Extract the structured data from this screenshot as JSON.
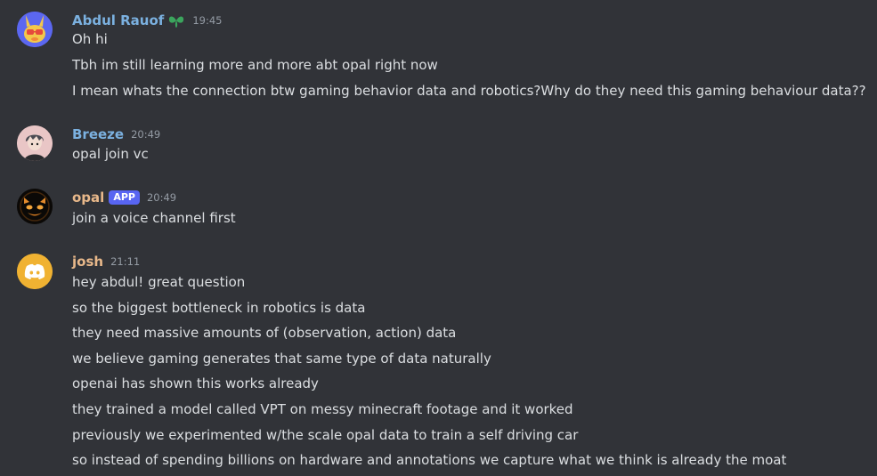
{
  "colors": {
    "background": "#313338",
    "text": "#dbdee1",
    "timestamp": "#949ba4",
    "app_badge": "#5865f2"
  },
  "messages": [
    {
      "username": "Abdul Rauof",
      "username_color": "#7bb1e0",
      "badge_icon": "leaf-icon",
      "time": "19:45",
      "avatar_icon": "yellow-bunny-avatar-icon",
      "lines": [
        "Oh hi",
        "Tbh im still learning more and more abt opal right now",
        "I mean whats the connection btw gaming behavior data and robotics?Why do they need this gaming behaviour data??"
      ]
    },
    {
      "username": "Breeze",
      "username_color": "#7bb1e0",
      "time": "20:49",
      "avatar_icon": "anime-boy-avatar-icon",
      "lines": [
        "opal join vc"
      ]
    },
    {
      "username": "opal",
      "username_color": "#e8b88a",
      "badge": "APP",
      "time": "20:49",
      "avatar_icon": "glowing-face-avatar-icon",
      "lines": [
        "join a voice channel first"
      ]
    },
    {
      "username": "josh",
      "username_color": "#e8b88a",
      "time": "21:11",
      "avatar_icon": "discord-logo-avatar-icon",
      "lines": [
        "hey abdul! great question",
        "so the biggest bottleneck in robotics is data",
        "they need massive amounts of (observation, action) data",
        "we believe gaming generates that same type of data naturally",
        "openai has shown this works already",
        "they trained a model called VPT on messy minecraft footage and it worked",
        "previously we experimented w/the scale opal data to train a self driving car",
        "so instead of spending billions on hardware and annotations we capture what we think is already the moat"
      ]
    }
  ]
}
